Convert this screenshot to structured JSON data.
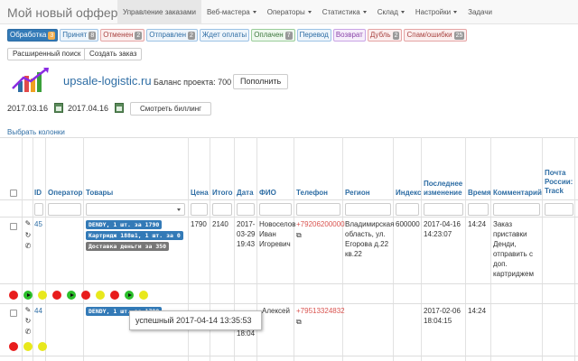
{
  "navbar": {
    "brand": "Мой новый оффер",
    "items": [
      {
        "label": "Управление заказами",
        "active": true,
        "dropdown": false
      },
      {
        "label": "Веб-мастера",
        "active": false,
        "dropdown": true
      },
      {
        "label": "Операторы",
        "active": false,
        "dropdown": true
      },
      {
        "label": "Статистика",
        "active": false,
        "dropdown": true
      },
      {
        "label": "Склад",
        "active": false,
        "dropdown": true
      },
      {
        "label": "Настройки",
        "active": false,
        "dropdown": true
      },
      {
        "label": "Задачи",
        "active": false,
        "dropdown": false
      }
    ]
  },
  "statuses": [
    {
      "label": "Обработка",
      "count": "3",
      "bg": "#337ab7",
      "border": "#2e6da4",
      "color": "#ffffff",
      "badge": "#f0ad4e"
    },
    {
      "label": "Принят",
      "count": "8",
      "bg": "#eef5fb",
      "border": "#9cc2e5",
      "color": "#2e6da4",
      "badge": "#999999"
    },
    {
      "label": "Отменен",
      "count": "2",
      "bg": "#fbeeee",
      "border": "#e5a4a4",
      "color": "#a94442",
      "badge": "#999999"
    },
    {
      "label": "Отправлен",
      "count": "2",
      "bg": "#eef5fb",
      "border": "#9cc2e5",
      "color": "#2e6da4",
      "badge": "#999999"
    },
    {
      "label": "Ждет оплаты",
      "count": "",
      "bg": "#eef5fb",
      "border": "#9cc2e5",
      "color": "#2e6da4",
      "badge": ""
    },
    {
      "label": "Оплачен",
      "count": "7",
      "bg": "#eef8ee",
      "border": "#99cc99",
      "color": "#3c763d",
      "badge": "#999999"
    },
    {
      "label": "Перевод",
      "count": "",
      "bg": "#eef5fb",
      "border": "#9cc2e5",
      "color": "#2e6da4",
      "badge": ""
    },
    {
      "label": "Возврат",
      "count": "",
      "bg": "#f6eefb",
      "border": "#c9a4e5",
      "color": "#8a44a9",
      "badge": ""
    },
    {
      "label": "Дубль",
      "count": "2",
      "bg": "#fbeeee",
      "border": "#e5a4a4",
      "color": "#a94442",
      "badge": "#999999"
    },
    {
      "label": "Спам/ошибки",
      "count": "25",
      "bg": "#fbeeee",
      "border": "#e5a4a4",
      "color": "#a94442",
      "badge": "#999999"
    }
  ],
  "actions": {
    "advanced_search": "Расширенный поиск",
    "create_order": "Создать заказ",
    "topup": "Пополнить",
    "billing": "Смотреть биллинг",
    "choose_columns": "Выбрать колонки"
  },
  "project": {
    "logo_text": "upsale-logistic.ru",
    "balance_label": "Баланс проекта: 700"
  },
  "dates": {
    "from": "2017.03.16",
    "to": "2017.04.16"
  },
  "columns": {
    "id": "ID",
    "operator": "Оператор",
    "products": "Товары",
    "price": "Цена",
    "total": "Итого",
    "date": "Дата",
    "fio": "ФИО",
    "phone": "Телефон",
    "region": "Регион",
    "index": "Индекс",
    "last_change": "Последнее изменение",
    "time": "Время",
    "comment": "Комментарий",
    "post": "Почта России: Track"
  },
  "rows": [
    {
      "id": "45",
      "products": [
        {
          "text": "DENDY, 1 шт. за 1790",
          "color": "#337ab7"
        },
        {
          "text": "Картридж 188в1, 1 шт. за 0",
          "color": "#337ab7"
        },
        {
          "text": "Доставка деньги за 350",
          "color": "#777777"
        }
      ],
      "price": "1790",
      "total": "2140",
      "date_lines": [
        "2017-",
        "03-29",
        "19:43"
      ],
      "fio_lines": [
        "Новоселов",
        "Иван",
        "Игоревич"
      ],
      "phone": "+79206200000",
      "region_lines": [
        "Владимирская",
        "область, ул.",
        "Егорова д.22",
        "кв.22"
      ],
      "index": "600000",
      "last_change_lines": [
        "2017-04-16",
        "14:23:07"
      ],
      "time": "14:24",
      "comment_lines": [
        "Заказ",
        "приставки",
        "Денди,",
        "отправить с",
        "доп.",
        "картриджем"
      ]
    },
    {
      "id": "44",
      "products": [
        {
          "text": "DENDY, 1 шт. за 1790",
          "color": "#337ab7"
        }
      ],
      "price": "",
      "total": "",
      "fio": "Алексей",
      "phone": "+79513324832",
      "last_change_lines": [
        "2017-02-06",
        "18:04:15"
      ],
      "time": "14:24",
      "date_tail": "18:04"
    }
  ],
  "dot_colors": {
    "red": "#e81c1c",
    "green": "#2bbf2b",
    "yellow": "#e8e81c"
  },
  "tooltip": "успешный 2017-04-14 13:35:53"
}
